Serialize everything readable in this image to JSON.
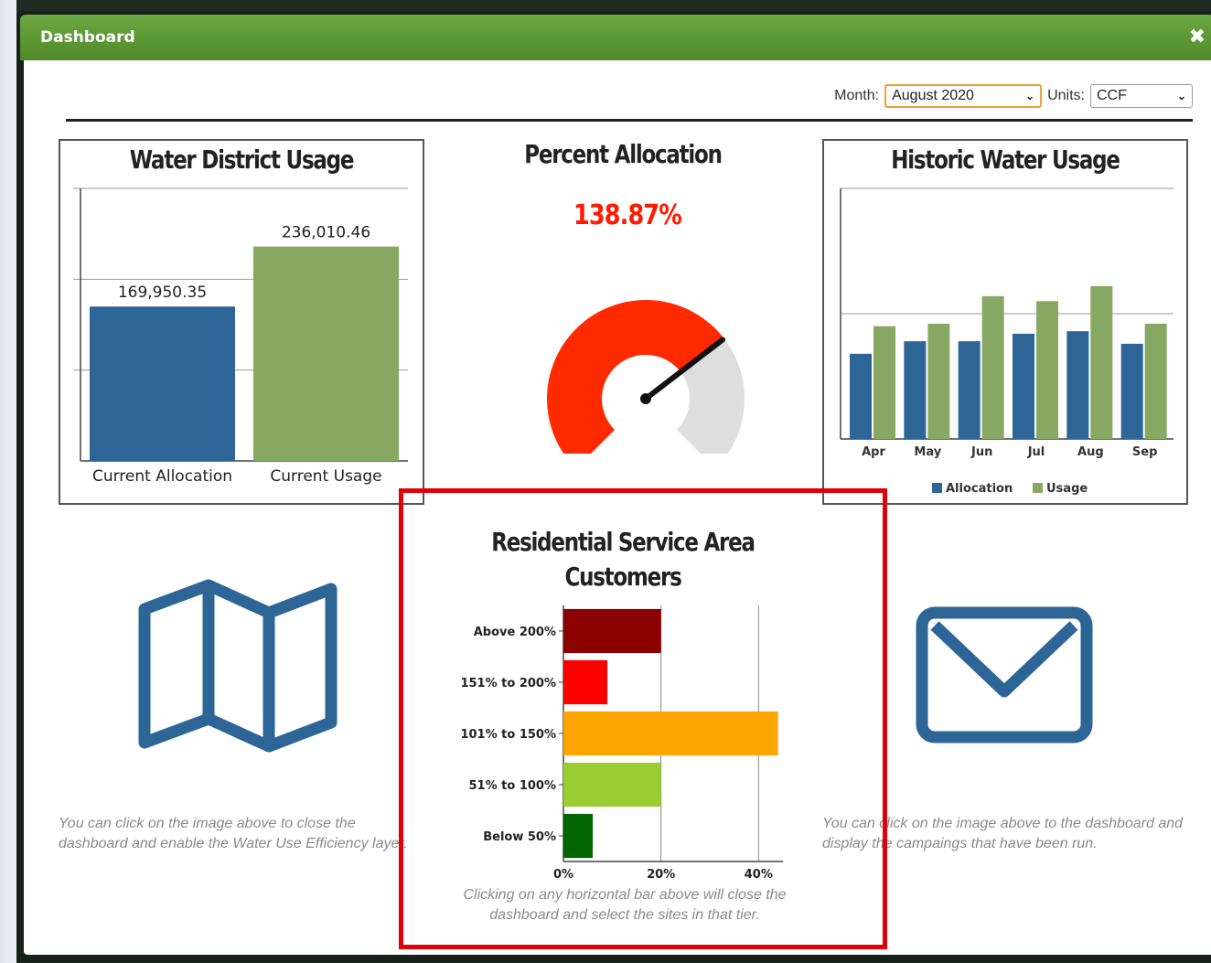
{
  "window": {
    "title": "Dashboard",
    "close_label": "✖"
  },
  "controls": {
    "month_label": "Month:",
    "month_value": "August 2020",
    "units_label": "Units:",
    "units_value": "CCF"
  },
  "water_district_usage": {
    "title": "Water District Usage",
    "chart_data": {
      "type": "bar",
      "categories": [
        "Current Allocation",
        "Current Usage"
      ],
      "values": [
        169950.35,
        236010.46
      ],
      "value_labels": [
        "169,950.35",
        "236,010.46"
      ],
      "ylim": [
        0,
        300000
      ],
      "grid": true,
      "colors": [
        "#2e6597",
        "#87a862"
      ]
    }
  },
  "percent_allocation": {
    "title": "Percent Allocation",
    "value_label": "138.87%",
    "gauge_fraction": 0.6943,
    "colors": {
      "filled": "#ff2a00",
      "empty": "#dedede",
      "needle": "#111111"
    }
  },
  "historic_water_usage": {
    "title": "Historic Water Usage",
    "chart_data": {
      "type": "bar",
      "categories": [
        "Apr",
        "May",
        "Jun",
        "Jul",
        "Aug",
        "Sep"
      ],
      "series": [
        {
          "name": "Allocation",
          "values": [
            34,
            39,
            39,
            42,
            43,
            38
          ],
          "color": "#2e6597"
        },
        {
          "name": "Usage",
          "values": [
            45,
            46,
            57,
            55,
            61,
            46
          ],
          "color": "#87a862"
        }
      ],
      "ylim": [
        0,
        100
      ],
      "grid": true,
      "legend_position": "bottom"
    }
  },
  "residential": {
    "title_line1": "Residential Service Area",
    "title_line2": "Customers",
    "chart_data": {
      "type": "bar",
      "orientation": "horizontal",
      "categories": [
        "Above 200%",
        "151% to 200%",
        "101% to 150%",
        "51% to 100%",
        "Below 50%"
      ],
      "values": [
        20,
        9,
        44,
        20,
        6
      ],
      "colors": [
        "#8b0000",
        "#ff0000",
        "#ffa500",
        "#9acd32",
        "#006400"
      ],
      "xlim": [
        0,
        45
      ],
      "xticks": [
        "0%",
        "20%",
        "40%"
      ],
      "grid": true
    },
    "hint": "Clicking on any horizontal bar above will close the dashboard and select the sites in that tier."
  },
  "map_card": {
    "icon": "map-icon",
    "hint": "You can click on the image above to close the dashboard and enable the Water Use Efficiency layer."
  },
  "mail_card": {
    "icon": "mail-icon",
    "hint": "You can click on the image above to the dashboard and display the campaings that have been run."
  }
}
